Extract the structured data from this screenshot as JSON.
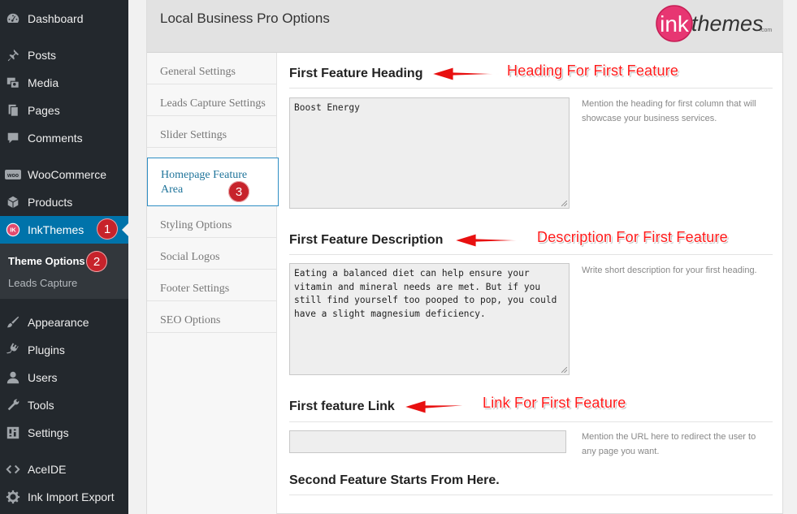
{
  "sidebar": {
    "items": [
      {
        "id": "dashboard",
        "label": "Dashboard",
        "icon": "dashboard-icon"
      },
      {
        "id": "posts",
        "label": "Posts",
        "icon": "pin-icon"
      },
      {
        "id": "media",
        "label": "Media",
        "icon": "media-icon"
      },
      {
        "id": "pages",
        "label": "Pages",
        "icon": "pages-icon"
      },
      {
        "id": "comments",
        "label": "Comments",
        "icon": "comment-icon"
      },
      {
        "id": "woocommerce",
        "label": "WooCommerce",
        "icon": "woo-icon"
      },
      {
        "id": "products",
        "label": "Products",
        "icon": "archive-icon"
      },
      {
        "id": "inkthemes",
        "label": "InkThemes",
        "icon": "inkthemes-icon"
      },
      {
        "id": "appearance",
        "label": "Appearance",
        "icon": "brush-icon"
      },
      {
        "id": "plugins",
        "label": "Plugins",
        "icon": "plugin-icon"
      },
      {
        "id": "users",
        "label": "Users",
        "icon": "user-icon"
      },
      {
        "id": "tools",
        "label": "Tools",
        "icon": "wrench-icon"
      },
      {
        "id": "settings",
        "label": "Settings",
        "icon": "settings-icon"
      },
      {
        "id": "aceide",
        "label": "AceIDE",
        "icon": "code-icon"
      },
      {
        "id": "ink-import-export",
        "label": "Ink Import Export",
        "icon": "gear-icon"
      }
    ],
    "submenu": [
      {
        "label": "Theme Options",
        "current": true
      },
      {
        "label": "Leads Capture",
        "current": false
      }
    ],
    "active_color": "#0073aa"
  },
  "panel": {
    "title": "Local Business Pro Options",
    "logo": {
      "main": "ink",
      "secondary": "themes",
      "suffix": ".com"
    },
    "tabs": [
      "General Settings",
      "Leads Capture Settings",
      "Slider Settings",
      "Homepage Feature Area",
      "Styling Options",
      "Social Logos",
      "Footer Settings",
      "SEO Options"
    ],
    "active_tab": "Homepage Feature Area"
  },
  "fields": {
    "heading": {
      "label": "First Feature Heading",
      "value": "Boost Energy",
      "help": "Mention the heading for first column that will showcase your business services."
    },
    "description": {
      "label": "First Feature Description",
      "value": "Eating a balanced diet can help ensure your vitamin and mineral needs are met. But if you still find yourself too pooped to pop, you could have a slight magnesium deficiency.",
      "help": "Write short description for your first heading."
    },
    "link": {
      "label": "First feature Link",
      "value": "",
      "help": "Mention the URL here to redirect the user to any page you want."
    },
    "second_section": "Second Feature Starts From Here."
  },
  "annotations": {
    "heading": "Heading For First Feature",
    "description": "Description For First Feature",
    "link": "Link For First Feature",
    "badges": [
      "1",
      "2",
      "3"
    ],
    "color": "#ff1a1a",
    "badge_color": "#c7232b"
  }
}
